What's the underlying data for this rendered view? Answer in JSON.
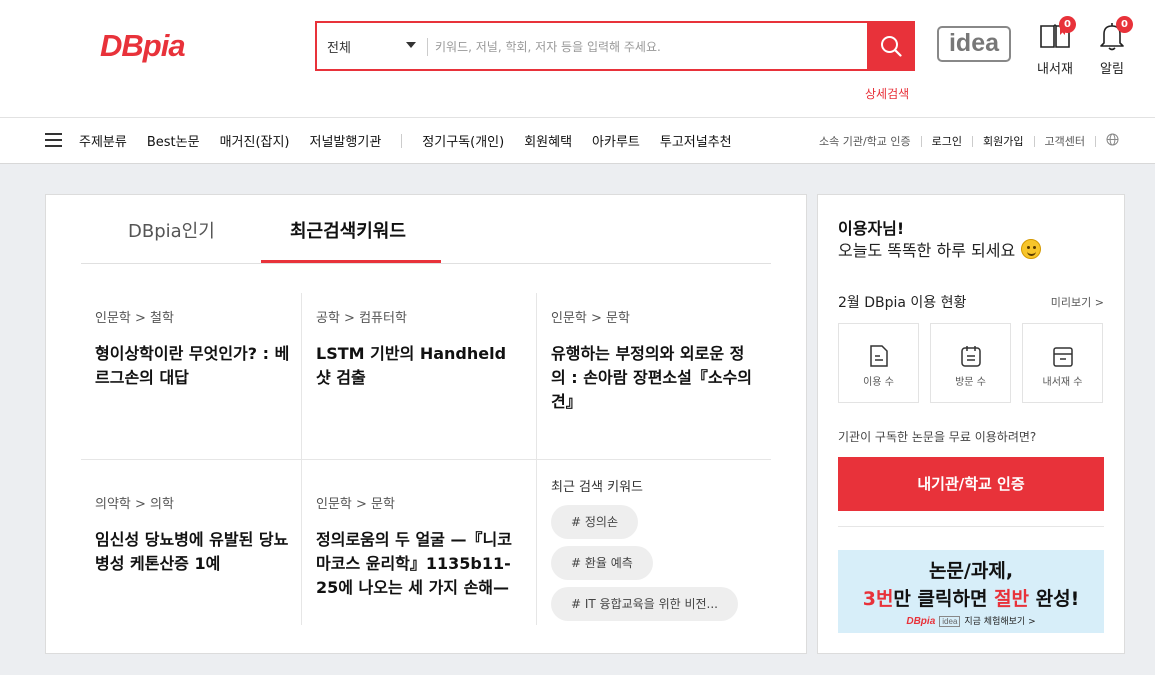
{
  "header": {
    "logo": "DBpia",
    "search_scope": "전체",
    "search_placeholder": "키워드, 저널, 학회, 저자 등을 입력해 주세요.",
    "advanced_search": "상세검색",
    "idea_logo": "idea",
    "library_label": "내서재",
    "library_count": "0",
    "alarm_label": "알림",
    "alarm_count": "0"
  },
  "nav": {
    "items": [
      "주제분류",
      "Best논문",
      "매거진(잡지)",
      "저널발행기관",
      "정기구독(개인)",
      "회원혜택",
      "아카루트",
      "투고저널추천"
    ],
    "right": [
      "소속 기관/학교 인증",
      "로그인",
      "회원가입",
      "고객센터"
    ]
  },
  "tabs": [
    "DBpia인기",
    "최근검색키워드"
  ],
  "papers": [
    {
      "category": "인문학 > 철학",
      "title": "형이상학이란 무엇인가? : 베르그손의 대답"
    },
    {
      "category": "공학 > 컴퓨터학",
      "title": "LSTM 기반의 Handheld 샷 검출"
    },
    {
      "category": "인문학 > 문학",
      "title": "유행하는 부정의와 외로운 정의 : 손아람 장편소설『소수의견』"
    },
    {
      "category": "의약학 > 의학",
      "title": "임신성 당뇨병에 유발된 당뇨병성 케톤산증 1예"
    },
    {
      "category": "인문학 > 문학",
      "title": "정의로움의 두 얼굴 —『니코마코스 윤리학』1135b11-25에 나오는 세 가지 손해—"
    }
  ],
  "recent_keywords": {
    "title": "최근 검색 키워드",
    "items": [
      "# 정의손",
      "# 환율 예측",
      "# IT 융합교육을 위한 비전..."
    ]
  },
  "side": {
    "greeting": "이용자님!",
    "greeting2": "오늘도 똑똑한 하루 되세요",
    "usage_title": "2월 DBpia 이용 현황",
    "preview": "미리보기 >",
    "stats": [
      "이용 수",
      "방문 수",
      "내서재 수"
    ],
    "inst_text": "기관이 구독한 논문을 무료 이용하려면?",
    "auth_button": "내기관/학교 인증",
    "banner": {
      "line1": "논문/과제,",
      "line2_a": "3번",
      "line2_b": "만 클릭하면 ",
      "line2_c": "절반",
      "line2_d": " 완성!",
      "small_logo": "DBpia",
      "small_idea": "idea",
      "cta": "지금 체험해보기 >"
    }
  },
  "colors": {
    "accent": "#e8323a",
    "banner_bg": "#d7eef9",
    "page_bg": "#eceef1"
  }
}
